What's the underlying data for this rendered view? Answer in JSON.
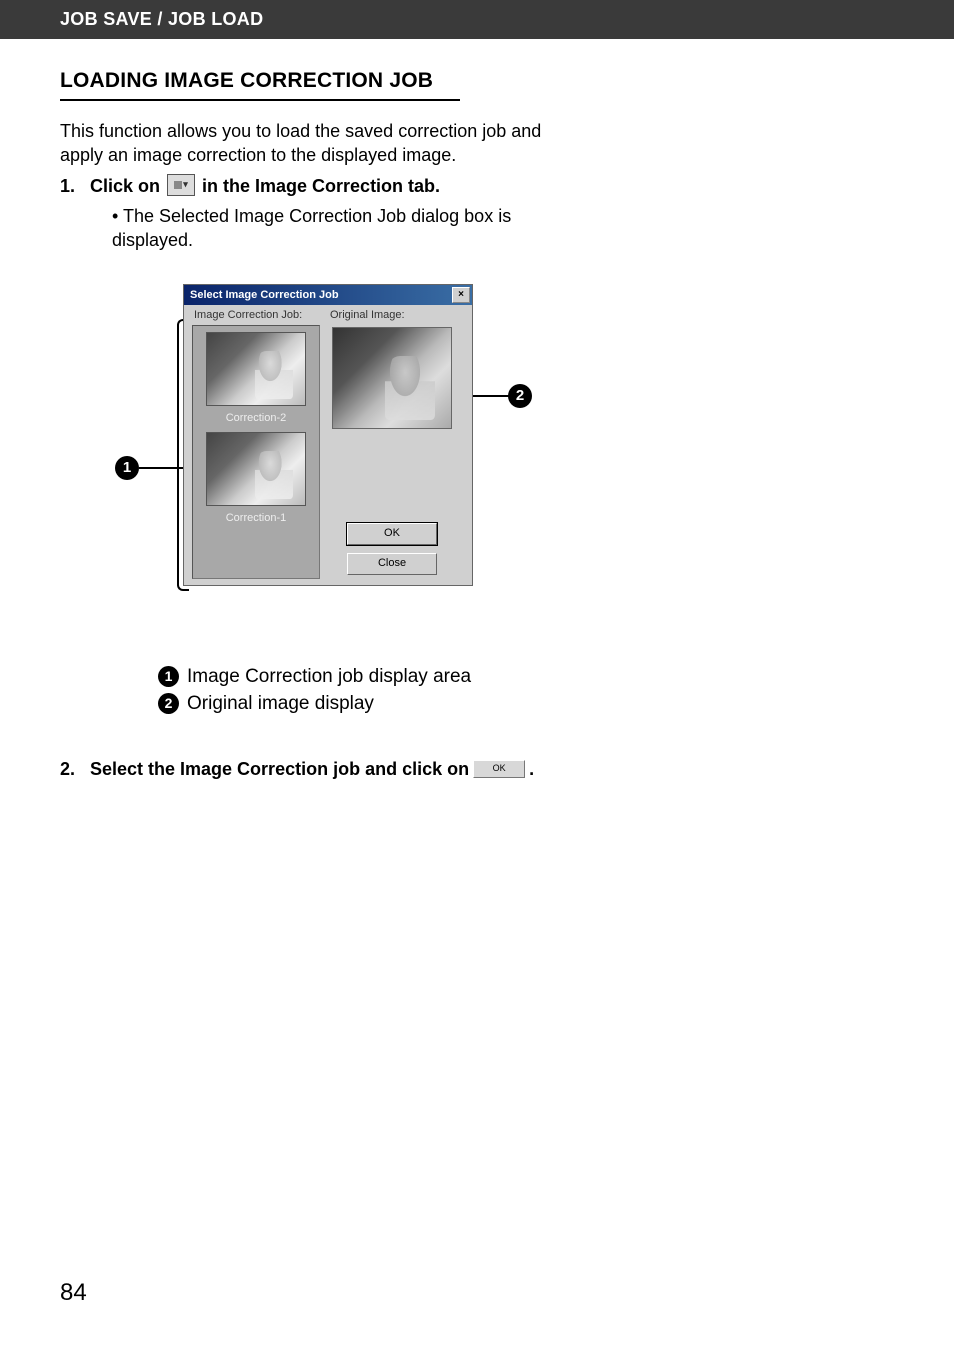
{
  "header": "JOB SAVE / JOB LOAD",
  "section_title": "LOADING IMAGE CORRECTION JOB",
  "intro": "This function allows you to load the saved correction job and apply an image correction to the displayed image.",
  "step1": {
    "num": "1.",
    "text_before": "Click on",
    "text_after": "in the Image Correction tab.",
    "bullet": "The Selected Image Correction Job dialog box is displayed."
  },
  "dialog": {
    "title": "Select Image Correction Job",
    "close_glyph": "×",
    "left_label": "Image Correction Job:",
    "right_label": "Original Image:",
    "jobs": [
      {
        "name": "Correction-2"
      },
      {
        "name": "Correction-1"
      }
    ],
    "ok_label": "OK",
    "close_label": "Close"
  },
  "callouts": {
    "c1": "1",
    "c2": "2"
  },
  "legend": {
    "l1": {
      "badge": "1",
      "text": "Image Correction job display area"
    },
    "l2": {
      "badge": "2",
      "text": "Original image display"
    }
  },
  "step2": {
    "num": "2.",
    "text_before": "Select the Image Correction job and click on",
    "ok_label": "OK",
    "text_after": "."
  },
  "page_number": "84"
}
